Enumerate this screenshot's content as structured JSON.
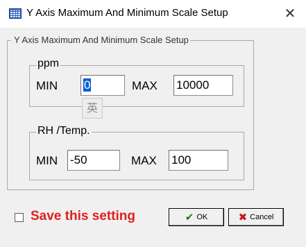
{
  "window": {
    "title": "Y Axis Maximum And Minimum Scale Setup",
    "close_glyph": "✕"
  },
  "main_group": {
    "legend": "Y Axis Maximum And Minimum Scale Setup"
  },
  "ppm": {
    "legend": "ppm",
    "min_label": "MIN",
    "min_value": "0",
    "max_label": "MAX",
    "max_value": "10000"
  },
  "ime_indicator": "英",
  "rh_temp": {
    "legend": "RH /Temp.",
    "min_label": "MIN",
    "min_value": "-50",
    "max_label": "MAX",
    "max_value": "100"
  },
  "save_setting": {
    "label": "Save this setting",
    "checked": false,
    "color": "#e02020"
  },
  "buttons": {
    "ok_icon": "✔",
    "ok_label": "OK",
    "ok_icon_color": "#1a7a1a",
    "cancel_icon": "✖",
    "cancel_label": "Cancel",
    "cancel_icon_color": "#c01818"
  }
}
